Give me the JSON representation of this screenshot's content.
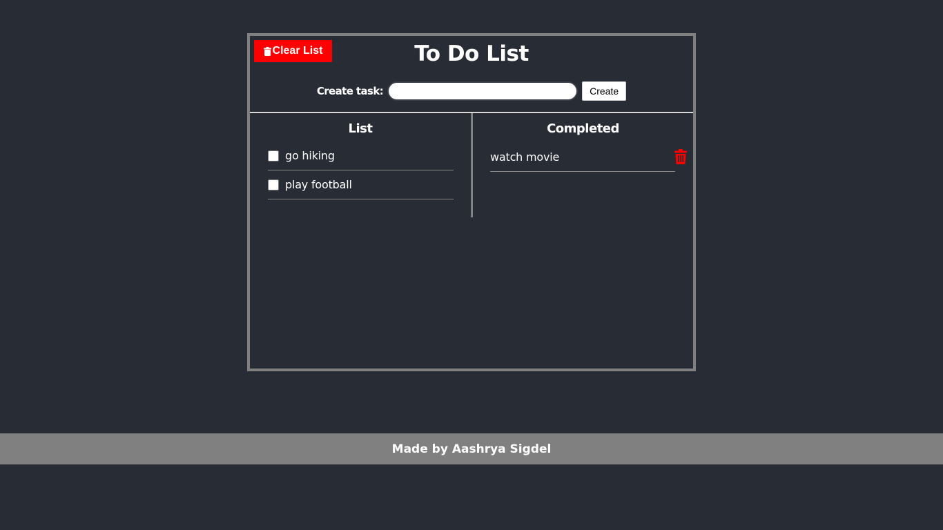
{
  "header": {
    "title": "To Do List",
    "clear_label": "Clear List",
    "clear_icon": "trash-icon"
  },
  "create": {
    "label": "Create task:",
    "input_value": "",
    "button_label": "Create"
  },
  "list": {
    "heading": "List",
    "items": [
      {
        "text": "go hiking",
        "checked": false
      },
      {
        "text": "play football",
        "checked": false
      }
    ]
  },
  "completed": {
    "heading": "Completed",
    "items": [
      {
        "text": "watch movie",
        "delete_icon": "trash-icon"
      }
    ]
  },
  "footer": {
    "text": "Made by Aashrya Sigdel"
  },
  "colors": {
    "background": "#282c34",
    "border": "#808080",
    "danger": "#ff0000",
    "text": "#ffffff"
  }
}
